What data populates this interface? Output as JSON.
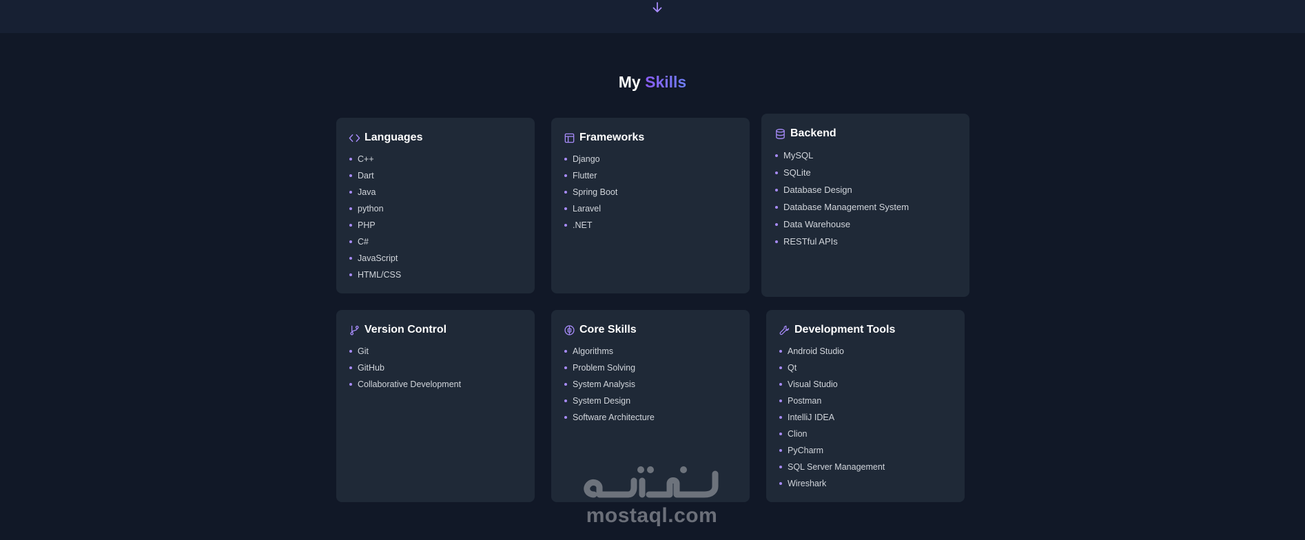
{
  "section": {
    "title_plain": "My",
    "title_accent": "Skills"
  },
  "watermark": {
    "text": "mostaql.com"
  },
  "cards": [
    {
      "title": "Languages",
      "icon": "code-icon",
      "items": [
        "C++",
        "Dart",
        "Java",
        "python",
        "PHP",
        "C#",
        "JavaScript",
        "HTML/CSS"
      ]
    },
    {
      "title": "Frameworks",
      "icon": "layout-icon",
      "items": [
        "Django",
        "Flutter",
        "Spring Boot",
        "Laravel",
        ".NET"
      ]
    },
    {
      "title": "Backend",
      "icon": "database-icon",
      "items": [
        "MySQL",
        "SQLite",
        "Database Design",
        "Database Management System",
        "Data Warehouse",
        "RESTful APIs"
      ]
    },
    {
      "title": "Version Control",
      "icon": "git-branch-icon",
      "items": [
        "Git",
        "GitHub",
        "Collaborative Development"
      ]
    },
    {
      "title": "Core Skills",
      "icon": "brain-icon",
      "items": [
        "Algorithms",
        "Problem Solving",
        "System Analysis",
        "System Design",
        "Software Architecture"
      ]
    },
    {
      "title": "Development Tools",
      "icon": "wrench-icon",
      "items": [
        "Android Studio",
        "Qt",
        "Visual Studio",
        "Postman",
        "IntelliJ IDEA",
        "Clion",
        "PyCharm",
        "SQL Server Management",
        "Wireshark"
      ]
    }
  ],
  "colors": {
    "accent": "#a78bfa",
    "background": "#111827",
    "card": "#1f2937"
  }
}
